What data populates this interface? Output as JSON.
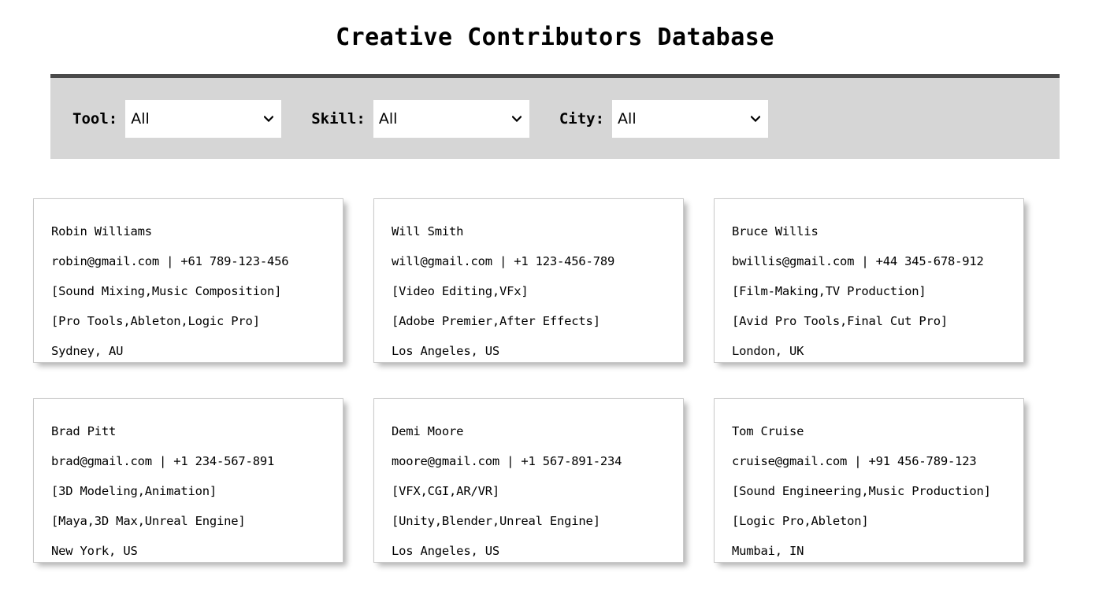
{
  "header": {
    "title": "Creative Contributors Database"
  },
  "filters": {
    "icons": {
      "dropdown_arrow": "chevron-down-icon"
    },
    "items": [
      {
        "label": "Tool:",
        "name": "tool",
        "selected": "All",
        "options": [
          "All"
        ]
      },
      {
        "label": "Skill:",
        "name": "skill",
        "selected": "All",
        "options": [
          "All"
        ]
      },
      {
        "label": "City:",
        "name": "city",
        "selected": "All",
        "options": [
          "All"
        ]
      }
    ]
  },
  "cards": [
    {
      "name": "Robin Williams",
      "contact": "robin@gmail.com | +61 789-123-456",
      "skills": "[Sound Mixing,Music Composition]",
      "tools": "[Pro Tools,Ableton,Logic Pro]",
      "location": "Sydney, AU"
    },
    {
      "name": "Will Smith",
      "contact": "will@gmail.com | +1 123-456-789",
      "skills": "[Video Editing,VFx]",
      "tools": "[Adobe Premier,After Effects]",
      "location": "Los Angeles, US"
    },
    {
      "name": "Bruce Willis",
      "contact": "bwillis@gmail.com | +44 345-678-912",
      "skills": "[Film-Making,TV Production]",
      "tools": "[Avid Pro Tools,Final Cut Pro]",
      "location": "London, UK"
    },
    {
      "name": "Brad Pitt",
      "contact": "brad@gmail.com | +1 234-567-891",
      "skills": "[3D Modeling,Animation]",
      "tools": "[Maya,3D Max,Unreal Engine]",
      "location": "New York, US"
    },
    {
      "name": "Demi Moore",
      "contact": "moore@gmail.com | +1 567-891-234",
      "skills": "[VFX,CGI,AR/VR]",
      "tools": "[Unity,Blender,Unreal Engine]",
      "location": "Los Angeles, US"
    },
    {
      "name": "Tom Cruise",
      "contact": "cruise@gmail.com | +91 456-789-123",
      "skills": "[Sound Engineering,Music Production]",
      "tools": "[Logic Pro,Ableton]",
      "location": "Mumbai, IN"
    }
  ],
  "colors": {
    "filter_bar_bg": "#d6d6d6",
    "filter_bar_border_top": "#4a4a4a",
    "card_border": "#c9c9c9",
    "page_bg": "#ffffff",
    "text": "#000000"
  }
}
